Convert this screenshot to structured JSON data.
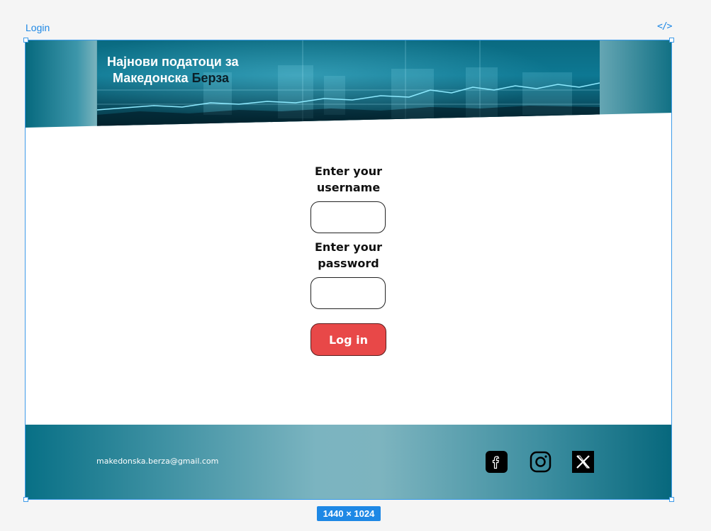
{
  "canvas": {
    "frame_name": "Login",
    "code_icon": "code-icon",
    "size_label": "1440 × 1024"
  },
  "header": {
    "title_line1": "Најнови податоци за",
    "title_line2_part1": "Македонска ",
    "title_line2_part2": "Берза"
  },
  "form": {
    "username_label": "Enter your username",
    "username_value": "",
    "password_label": "Enter your password",
    "password_value": "",
    "login_label": "Log in",
    "login_color": "#e84848"
  },
  "footer": {
    "email": "makedonska.berza@gmail.com",
    "social": [
      "facebook-icon",
      "instagram-icon",
      "x-icon"
    ]
  },
  "colors": {
    "accent": "#1e88e5",
    "banner": "#0e6f86"
  }
}
